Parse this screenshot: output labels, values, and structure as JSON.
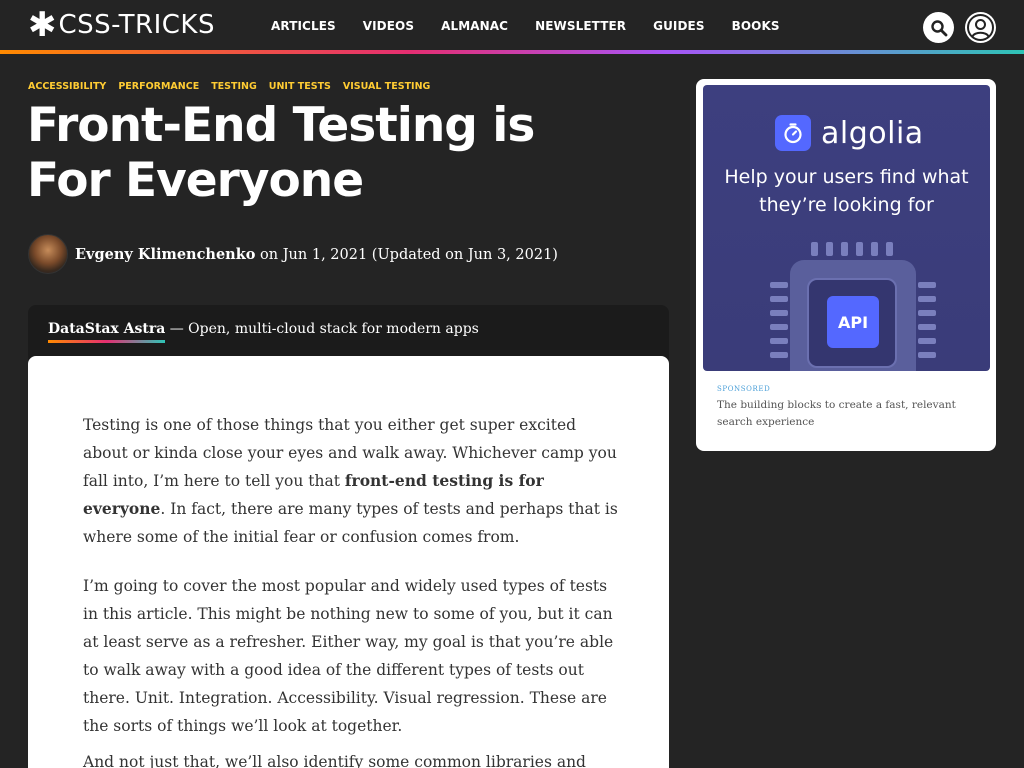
{
  "header": {
    "logo_star": "✱",
    "logo_text": "CSS-TRICKS",
    "nav": [
      "ARTICLES",
      "VIDEOS",
      "ALMANAC",
      "NEWSLETTER",
      "GUIDES",
      "BOOKS"
    ],
    "search_icon": "search-icon",
    "account_icon": "user-icon"
  },
  "article": {
    "tags": [
      "ACCESSIBILITY",
      "PERFORMANCE",
      "TESTING",
      "UNIT TESTS",
      "VISUAL TESTING"
    ],
    "title": "Front-End Testing is For Everyone",
    "author": "Evgeny Klimenchenko",
    "date_text": " on Jun 1, 2021 (Updated on Jun 3, 2021)",
    "p1_a": "Testing is one of those things that you either get super excited about or kinda close your eyes and walk away. Whichever camp you fall into, I’m here to tell you that ",
    "p1_bold": "front-end testing is for everyone",
    "p1_b": ". In fact, there are many types of tests and perhaps that is where some of the initial fear or confusion comes from.",
    "p2": "I’m going to cover the most popular and widely used types of tests in this article. This might be nothing new to some of you, but it can at least serve as a refresher. Either way, my goal is that you’re able to walk away with a good idea of the different types of tests out there. Unit. Integration. Accessibility. Visual regression. These are the sorts of things we’ll look at together.",
    "p3": "And not just that, we’ll also identify some common libraries and"
  },
  "sponsor_strip": {
    "brand": "DataStax Astra",
    "tagline": " — Open, multi-cloud stack for modern apps"
  },
  "ad": {
    "brand": "algolia",
    "headline": "Help your users find what they’re looking for",
    "chip_label": "API",
    "sponsored_label": "SPONSORED",
    "description": "The building blocks to create a fast, relevant search experience"
  }
}
